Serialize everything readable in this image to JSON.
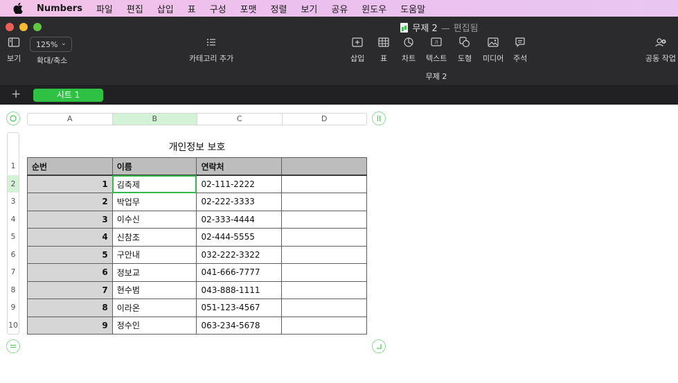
{
  "menubar": {
    "app_name": "Numbers",
    "items": [
      "파일",
      "편집",
      "삽입",
      "표",
      "구성",
      "포맷",
      "정렬",
      "보기",
      "공유",
      "윈도우",
      "도움말"
    ]
  },
  "window": {
    "title": "무제 2",
    "separator": "—",
    "status": "편집됨"
  },
  "toolbar": {
    "view_label": "보기",
    "zoom_value": "125%",
    "zoom_label": "확대/축소",
    "category_label": "카테고리 추가",
    "insert_label": "삽입",
    "table_label": "표",
    "chart_label": "차트",
    "text_label": "텍스트",
    "shape_label": "도형",
    "media_label": "미디어",
    "comment_label": "주석",
    "collaborate_label": "공동 작업",
    "subtitle": "무제 2"
  },
  "sheets": {
    "add_label": "+",
    "tabs": [
      {
        "label": "시트 1"
      }
    ]
  },
  "spreadsheet": {
    "title": "개인정보 보호",
    "column_headers": [
      "A",
      "B",
      "C",
      "D"
    ],
    "row_headers": [
      "1",
      "2",
      "3",
      "4",
      "5",
      "6",
      "7",
      "8",
      "9",
      "10"
    ],
    "selected_cell": "B2",
    "header_row": [
      "순번",
      "이름",
      "연락처",
      ""
    ],
    "rows": [
      [
        "1",
        "김축제",
        "02-111-2222",
        ""
      ],
      [
        "2",
        "박업무",
        "02-222-3333",
        ""
      ],
      [
        "3",
        "이수신",
        "02-333-4444",
        ""
      ],
      [
        "4",
        "신참조",
        "02-444-5555",
        ""
      ],
      [
        "5",
        "구안내",
        "032-222-3322",
        ""
      ],
      [
        "6",
        "정보교",
        "041-666-7777",
        ""
      ],
      [
        "7",
        "현수범",
        "043-888-1111",
        ""
      ],
      [
        "8",
        "이라온",
        "051-123-4567",
        ""
      ],
      [
        "9",
        "정수인",
        "063-234-5678",
        ""
      ]
    ]
  },
  "colors": {
    "accent": "#2fc143",
    "selection": "#d3f2d6",
    "header_fill": "#bdbdbd",
    "index_fill": "#d6d6d6"
  }
}
